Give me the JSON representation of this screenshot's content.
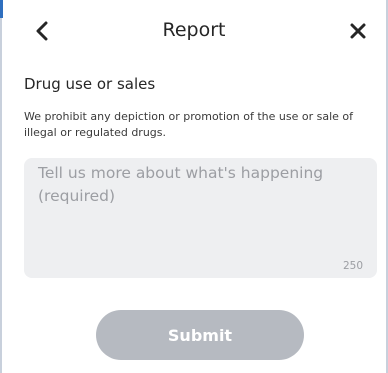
{
  "header": {
    "title": "Report",
    "back_icon": "chevron-left-icon",
    "close_icon": "close-icon"
  },
  "report": {
    "category_title": "Drug use or sales",
    "category_description": "We prohibit any depiction or promotion of the use or sale of illegal or regulated drugs.",
    "details_placeholder": "Tell us more about what's happening (required)",
    "details_value": "",
    "char_count": "250"
  },
  "actions": {
    "submit_label": "Submit",
    "submit_enabled": false
  },
  "colors": {
    "text": "#262626",
    "input_background": "#eeeff1",
    "placeholder": "#9c9ea3",
    "submit_disabled": "#b6bac1"
  }
}
